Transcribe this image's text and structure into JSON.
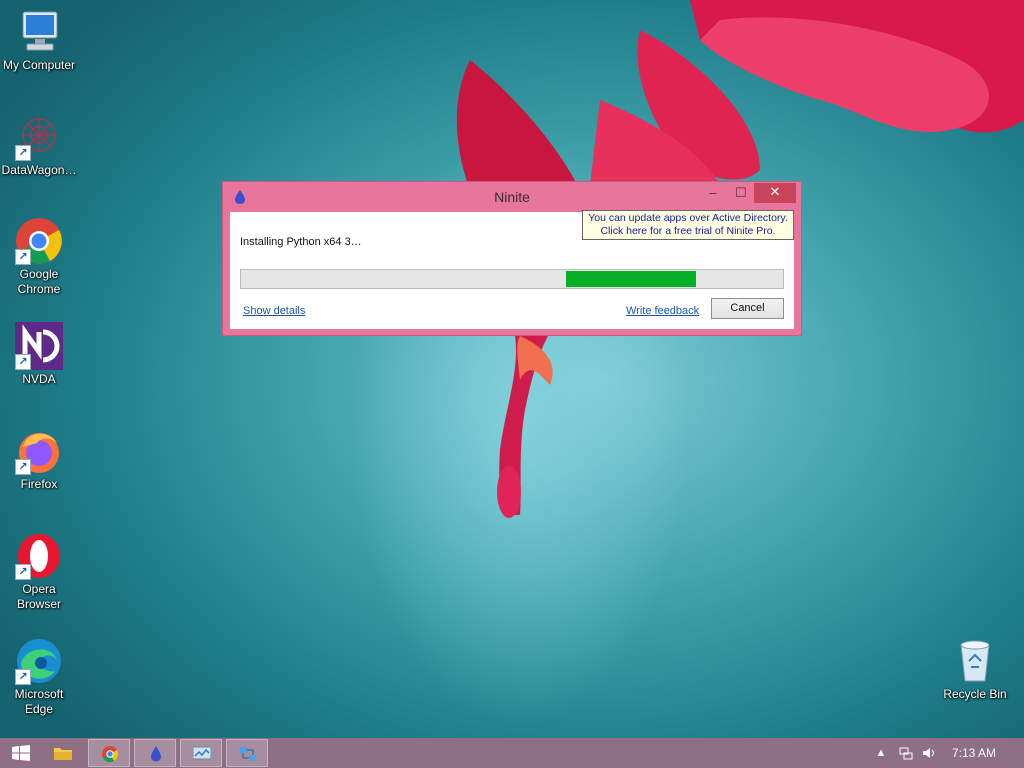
{
  "desktop": {
    "icons": [
      {
        "label": "My Computer",
        "icon": "computer-icon"
      },
      {
        "label": "DataWagon…",
        "icon": "datawagon-icon"
      },
      {
        "label": "Google Chrome",
        "icon": "chrome-icon"
      },
      {
        "label": "NVDA",
        "icon": "nvda-icon"
      },
      {
        "label": "Firefox",
        "icon": "firefox-icon"
      },
      {
        "label": "Opera Browser",
        "icon": "opera-icon"
      },
      {
        "label": "Microsoft Edge",
        "icon": "edge-icon"
      },
      {
        "label": "Recycle Bin",
        "icon": "recycle-bin-icon"
      }
    ]
  },
  "window": {
    "title": "Ninite",
    "status_text": "Installing Python x64 3…",
    "progress": {
      "start": 0.6,
      "end": 0.84,
      "color": "#06b025"
    },
    "show_details_label": "Show details",
    "write_feedback_label": "Write feedback",
    "cancel_label": "Cancel",
    "minimize_glyph": "–",
    "maximize_glyph": "☐",
    "close_glyph": "✕",
    "tooltip": {
      "line1": "You can update apps over Active Directory.",
      "line2": "Click here for a free trial of Ninite Pro."
    },
    "frame_color": "#e8759b"
  },
  "taskbar": {
    "items": [
      "start-icon",
      "file-explorer-icon",
      "chrome-icon",
      "ninite-icon",
      "system-monitor-icon",
      "network-tool-icon"
    ],
    "clock": "7:13 AM",
    "color": "#8e6f84"
  }
}
